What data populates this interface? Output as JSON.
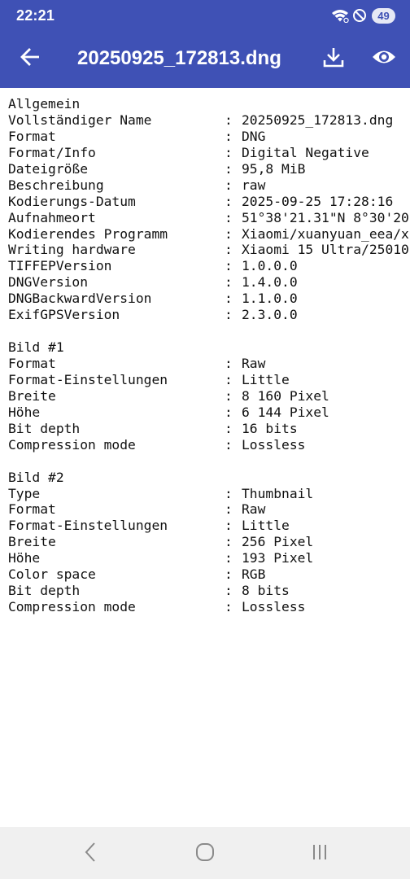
{
  "status_bar": {
    "time": "22:21",
    "battery": "49",
    "icons": [
      "wifi-question-icon",
      "do-not-disturb-icon",
      "battery-icon"
    ]
  },
  "app_bar": {
    "title": "20250925_172813.dng",
    "icons": [
      "arrow-back-icon",
      "download-icon",
      "eye-icon"
    ],
    "color": "#3f51b5"
  },
  "sections": [
    {
      "heading": "Allgemein",
      "rows": [
        {
          "label": "Vollständiger Name",
          "value": "20250925_172813.dng"
        },
        {
          "label": "Format",
          "value": "DNG"
        },
        {
          "label": "Format/Info",
          "value": "Digital Negative"
        },
        {
          "label": "Dateigröße",
          "value": "95,8 MiB"
        },
        {
          "label": "Beschreibung",
          "value": "raw"
        },
        {
          "label": "Kodierungs-Datum",
          "value": "2025-09-25 17:28:16"
        },
        {
          "label": "Aufnahmeort",
          "value": "51°38'21.31\"N 8°30'20"
        },
        {
          "label": "Kodierendes Programm",
          "value": "Xiaomi/xuanyuan_eea/x"
        },
        {
          "label": "Writing hardware",
          "value": "Xiaomi 15 Ultra/25010"
        },
        {
          "label": "TIFFEPVersion",
          "value": "1.0.0.0"
        },
        {
          "label": "DNGVersion",
          "value": "1.4.0.0"
        },
        {
          "label": "DNGBackwardVersion",
          "value": "1.1.0.0"
        },
        {
          "label": "ExifGPSVersion",
          "value": "2.3.0.0"
        }
      ]
    },
    {
      "heading": "Bild #1",
      "rows": [
        {
          "label": "Format",
          "value": "Raw"
        },
        {
          "label": "Format-Einstellungen",
          "value": "Little"
        },
        {
          "label": "Breite",
          "value": "8 160 Pixel"
        },
        {
          "label": "Höhe",
          "value": "6 144 Pixel"
        },
        {
          "label": "Bit depth",
          "value": "16 bits"
        },
        {
          "label": "Compression mode",
          "value": "Lossless"
        }
      ]
    },
    {
      "heading": "Bild #2",
      "rows": [
        {
          "label": "Type",
          "value": "Thumbnail"
        },
        {
          "label": "Format",
          "value": "Raw"
        },
        {
          "label": "Format-Einstellungen",
          "value": "Little"
        },
        {
          "label": "Breite",
          "value": "256 Pixel"
        },
        {
          "label": "Höhe",
          "value": "193 Pixel"
        },
        {
          "label": "Color space",
          "value": "RGB"
        },
        {
          "label": "Bit depth",
          "value": "8 bits"
        },
        {
          "label": "Compression mode",
          "value": "Lossless"
        }
      ]
    }
  ],
  "separator": ":",
  "nav_bar": {
    "icons": [
      "nav-back-icon",
      "nav-home-icon",
      "nav-recents-icon"
    ]
  }
}
